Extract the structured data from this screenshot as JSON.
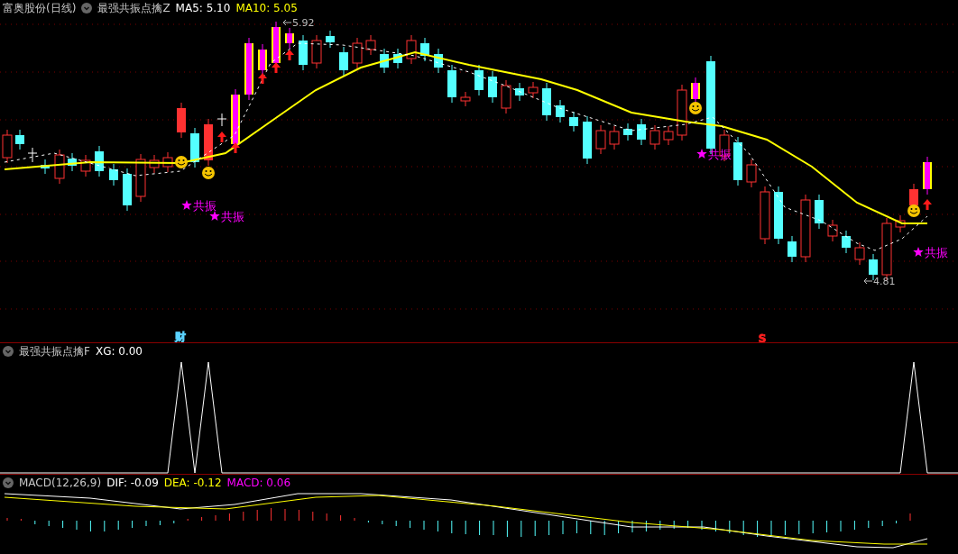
{
  "main_panel": {
    "title": "富奥股份(日线)",
    "indicator": "最强共振点擒Z",
    "readings": [
      {
        "label": "MA5: 5.10",
        "color": "#ffffff"
      },
      {
        "label": "MA10: 5.05",
        "color": "#ffff00"
      }
    ],
    "price_labels": [
      "5.92",
      "4.81"
    ],
    "signals": [
      "共振",
      "共振",
      "共振",
      "共振"
    ],
    "event_markers": [
      {
        "label": "财",
        "color": "#5ad2ff"
      },
      {
        "label": "S",
        "color": "#ff2020"
      }
    ]
  },
  "xg_panel": {
    "title": "最强共振点擒F",
    "readings": [
      {
        "label": "XG: 0.00",
        "color": "#ffffff"
      }
    ]
  },
  "macd_panel": {
    "title": "MACD(12,26,9)",
    "readings": [
      {
        "label": "DIF: -0.09",
        "color": "#ffffff"
      },
      {
        "label": "DEA: -0.12",
        "color": "#ffff00"
      },
      {
        "label": "MACD: 0.06",
        "color": "#ff00ff"
      }
    ]
  }
}
